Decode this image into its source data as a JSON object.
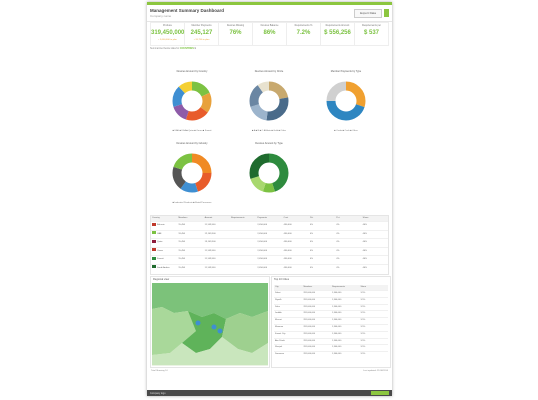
{
  "header": {
    "title": "Management Summary Dashboard",
    "subtitle": "Company name",
    "export_label": "Export Data"
  },
  "kpis": [
    {
      "label": "Produce",
      "value": "319,450,000",
      "sub": "+ 3,000,000 to plan"
    },
    {
      "label": "Member Payments",
      "value": "245,127",
      "sub": "+ 20,750 to plan"
    },
    {
      "label": "Devices Missing",
      "value": "76%",
      "sub": ""
    },
    {
      "label": "Devices Balance",
      "value": "86%",
      "sub": ""
    },
    {
      "label": "Requirements %",
      "value": "7.2%",
      "sub": ""
    },
    {
      "label": "Requirements Amount",
      "value": "$ 556,256",
      "sub": ""
    },
    {
      "label": "Requirements per",
      "value": "$ 537",
      "sub": ""
    }
  ],
  "filter": {
    "label": "Summarized below data for",
    "value": "COUNTRIES"
  },
  "charts": [
    {
      "title": "Devices Amount by Country",
      "legend": "■ UAE ■ KSA ■ Qatar ■ Oman ■ Kuwait",
      "colors": [
        "#7cc242",
        "#e8a13b",
        "#e85c2b",
        "#8e5ba8",
        "#3f8fd2",
        "#f5d033"
      ],
      "values": [
        18,
        17,
        20,
        15,
        18,
        12
      ]
    },
    {
      "title": "Devices Amount by Circle",
      "legend": "■ A ■ B  ■ C Affiliate ■ Gold ■ Other",
      "colors": [
        "#c8a96e",
        "#4a6b8a",
        "#9cb4cc",
        "#6a86a3",
        "#e8e2cf"
      ],
      "values": [
        22,
        30,
        18,
        20,
        10
      ]
    },
    {
      "title": "Member Payments by Type",
      "legend": "■ Cards ■ Cash ■ Other",
      "colors": [
        "#f0a030",
        "#2e86c1",
        "#d0d0d0"
      ],
      "values": [
        30,
        45,
        25
      ]
    },
    {
      "title": "Devices Amount by Industry",
      "legend": "■ Industrial Products ■ Retail/Consumer",
      "colors": [
        "#f08a24",
        "#e85c2b",
        "#3f8fd2",
        "#555555",
        "#7cc242"
      ],
      "values": [
        25,
        20,
        15,
        20,
        20
      ]
    },
    {
      "title": "Devices Amount by Type",
      "legend": "",
      "colors": [
        "#2e8b3e",
        "#7cc242",
        "#a8d86e",
        "#1f6b2e"
      ],
      "values": [
        45,
        10,
        15,
        30
      ]
    }
  ],
  "table": {
    "columns": [
      "Country",
      "Members",
      "Amount",
      "Requirements",
      "Payments",
      "Cost",
      "Pct",
      "Pct",
      "Share"
    ],
    "rows": [
      {
        "flag": "#c0392b",
        "cells": [
          "Bahrain",
          "15,456",
          "11,149,500",
          "",
          "2,456,000",
          "456,000",
          "4%",
          "4%",
          "46%"
        ]
      },
      {
        "flag": "#7cc242",
        "cells": [
          "UAE",
          "19,456",
          "12,149,500",
          "",
          "2,456,000",
          "456,000",
          "4%",
          "4%",
          "46%"
        ]
      },
      {
        "flag": "#8e1c3b",
        "cells": [
          "Qatar",
          "15,456",
          "13,149,500",
          "",
          "2,456,000",
          "456,000",
          "4%",
          "4%",
          "46%"
        ]
      },
      {
        "flag": "#c0392b",
        "cells": [
          "Oman",
          "15,456",
          "11,149,500",
          "",
          "2,456,000",
          "456,000",
          "4%",
          "4%",
          "46%"
        ]
      },
      {
        "flag": "#2e8b3e",
        "cells": [
          "Kuwait",
          "15,456",
          "11,149,500",
          "",
          "2,456,000",
          "456,000",
          "4%",
          "4%",
          "46%"
        ]
      },
      {
        "flag": "#1f6b2e",
        "cells": [
          "Saudi Arabia",
          "15,456",
          "11,149,500",
          "",
          "2,456,000",
          "456,000",
          "4%",
          "4%",
          "46%"
        ]
      }
    ]
  },
  "map": {
    "title": "Regional view"
  },
  "cities": {
    "title": "Top 10 Cities",
    "columns": [
      "City",
      "Members",
      "Requirements",
      "Share"
    ],
    "rows": [
      [
        "Dubai",
        "281,000,000",
        "1,346,000",
        "3.5%"
      ],
      [
        "Riyadh",
        "281,000,000",
        "1,346,000",
        "3.5%"
      ],
      [
        "Doha",
        "281,000,000",
        "1,346,000",
        "3.5%"
      ],
      [
        "Jeddah",
        "281,000,000",
        "1,346,000",
        "3.5%"
      ],
      [
        "Muscat",
        "281,000,000",
        "1,346,000",
        "3.5%"
      ],
      [
        "Manama",
        "281,000,000",
        "1,346,000",
        "3.5%"
      ],
      [
        "Kuwait City",
        "281,000,000",
        "1,346,000",
        "3.5%"
      ],
      [
        "Abu Dhabi",
        "281,000,000",
        "1,346,000",
        "3.5%"
      ],
      [
        "Sharjah",
        "281,000,000",
        "1,346,000",
        "3.5%"
      ],
      [
        "Dammam",
        "281,000,000",
        "1,346,000",
        "3.5%"
      ]
    ]
  },
  "footer": {
    "left": "Total  Showing 10",
    "right": "Last updated: 21/06/2014"
  },
  "bottombar": {
    "left": "Company logo"
  }
}
